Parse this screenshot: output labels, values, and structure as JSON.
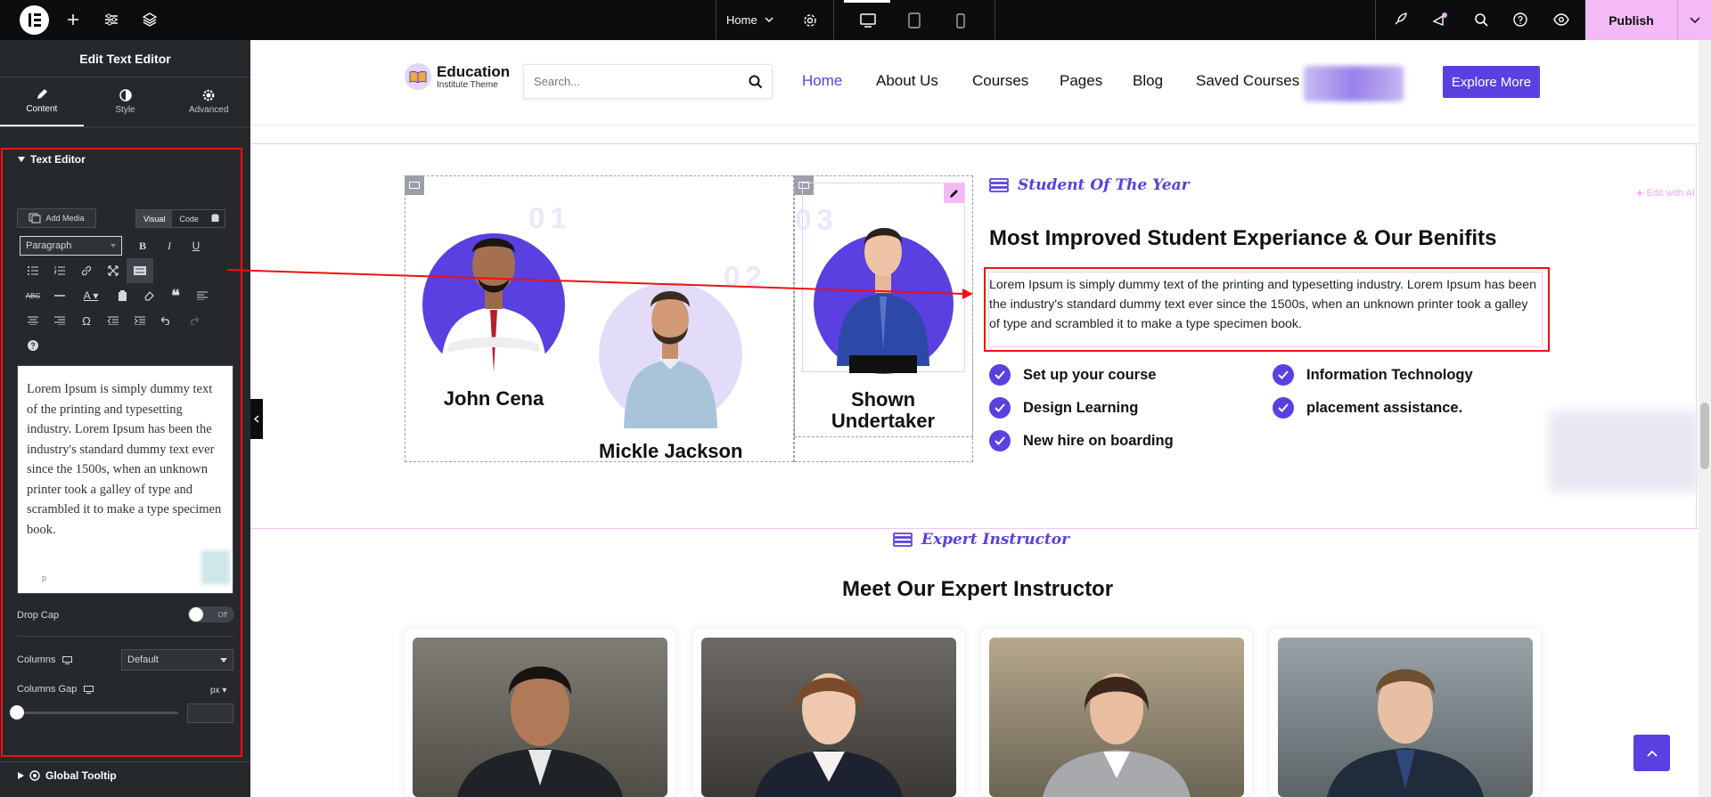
{
  "topbar": {
    "page_selector": "Home",
    "publish_label": "Publish",
    "icons": [
      "elementor-logo-icon",
      "add-icon",
      "site-settings-icon",
      "structure-icon",
      "settings-gear-icon",
      "desktop-icon",
      "tablet-icon",
      "mobile-icon",
      "launch-icon",
      "notifications-icon",
      "search-icon",
      "help-icon",
      "preview-icon",
      "chevron-down-icon"
    ]
  },
  "panel": {
    "title": "Edit Text Editor",
    "tabs": [
      {
        "label": "Content",
        "icon": "pencil-icon"
      },
      {
        "label": "Style",
        "icon": "half-circle-icon"
      },
      {
        "label": "Advanced",
        "icon": "gear-icon"
      }
    ],
    "section_title": "Text Editor",
    "edit_with_ai": "Edit with AI",
    "add_media": "Add Media",
    "visual_tab": "Visual",
    "code_tab": "Code",
    "format_select": "Paragraph",
    "editor_text": "Lorem Ipsum is simply dummy text of the printing and typesetting industry. Lorem Ipsum has been the industry's standard dummy text ever since the 1500s, when an unknown printer took a galley of type and scrambled it to make a type specimen book.",
    "editor_path": "p",
    "drop_cap_label": "Drop Cap",
    "drop_cap_state": "Off",
    "columns_label": "Columns",
    "columns_value": "Default",
    "columns_gap_label": "Columns Gap",
    "columns_gap_unit": "px",
    "columns_gap_value": "",
    "global_tooltip": "Global Tooltip"
  },
  "site": {
    "brand_name": "Education",
    "brand_sub": "Institute Theme",
    "search_placeholder": "Search...",
    "nav": [
      "Home",
      "About Us",
      "Courses",
      "Pages",
      "Blog",
      "Saved Courses"
    ],
    "cta": "Explore More",
    "students": [
      {
        "name": "John Cena",
        "number": "01"
      },
      {
        "name": "Mickle Jackson",
        "number": "02"
      },
      {
        "name": "Shown Undertaker",
        "number": "03"
      }
    ],
    "tagline": "Student Of The Year",
    "heading": "Most Improved Student Experiance & Our Benifits",
    "paragraph": "Lorem Ipsum is simply dummy text of the printing and typesetting industry. Lorem Ipsum has been the industry's standard dummy text ever since the 1500s, when an unknown printer took a galley of type and scrambled it to make a type specimen book.",
    "benefits": [
      "Set up your course",
      "Information Technology",
      "Design Learning",
      "placement assistance.",
      "New hire on boarding"
    ],
    "instructor_tag": "Expert Instructor",
    "instructor_heading": "Meet Our Expert Instructor"
  },
  "colors": {
    "accent": "#5a40e0",
    "publish": "#f3baf7",
    "panel_bg": "#26292c",
    "highlight": "#e11111"
  }
}
